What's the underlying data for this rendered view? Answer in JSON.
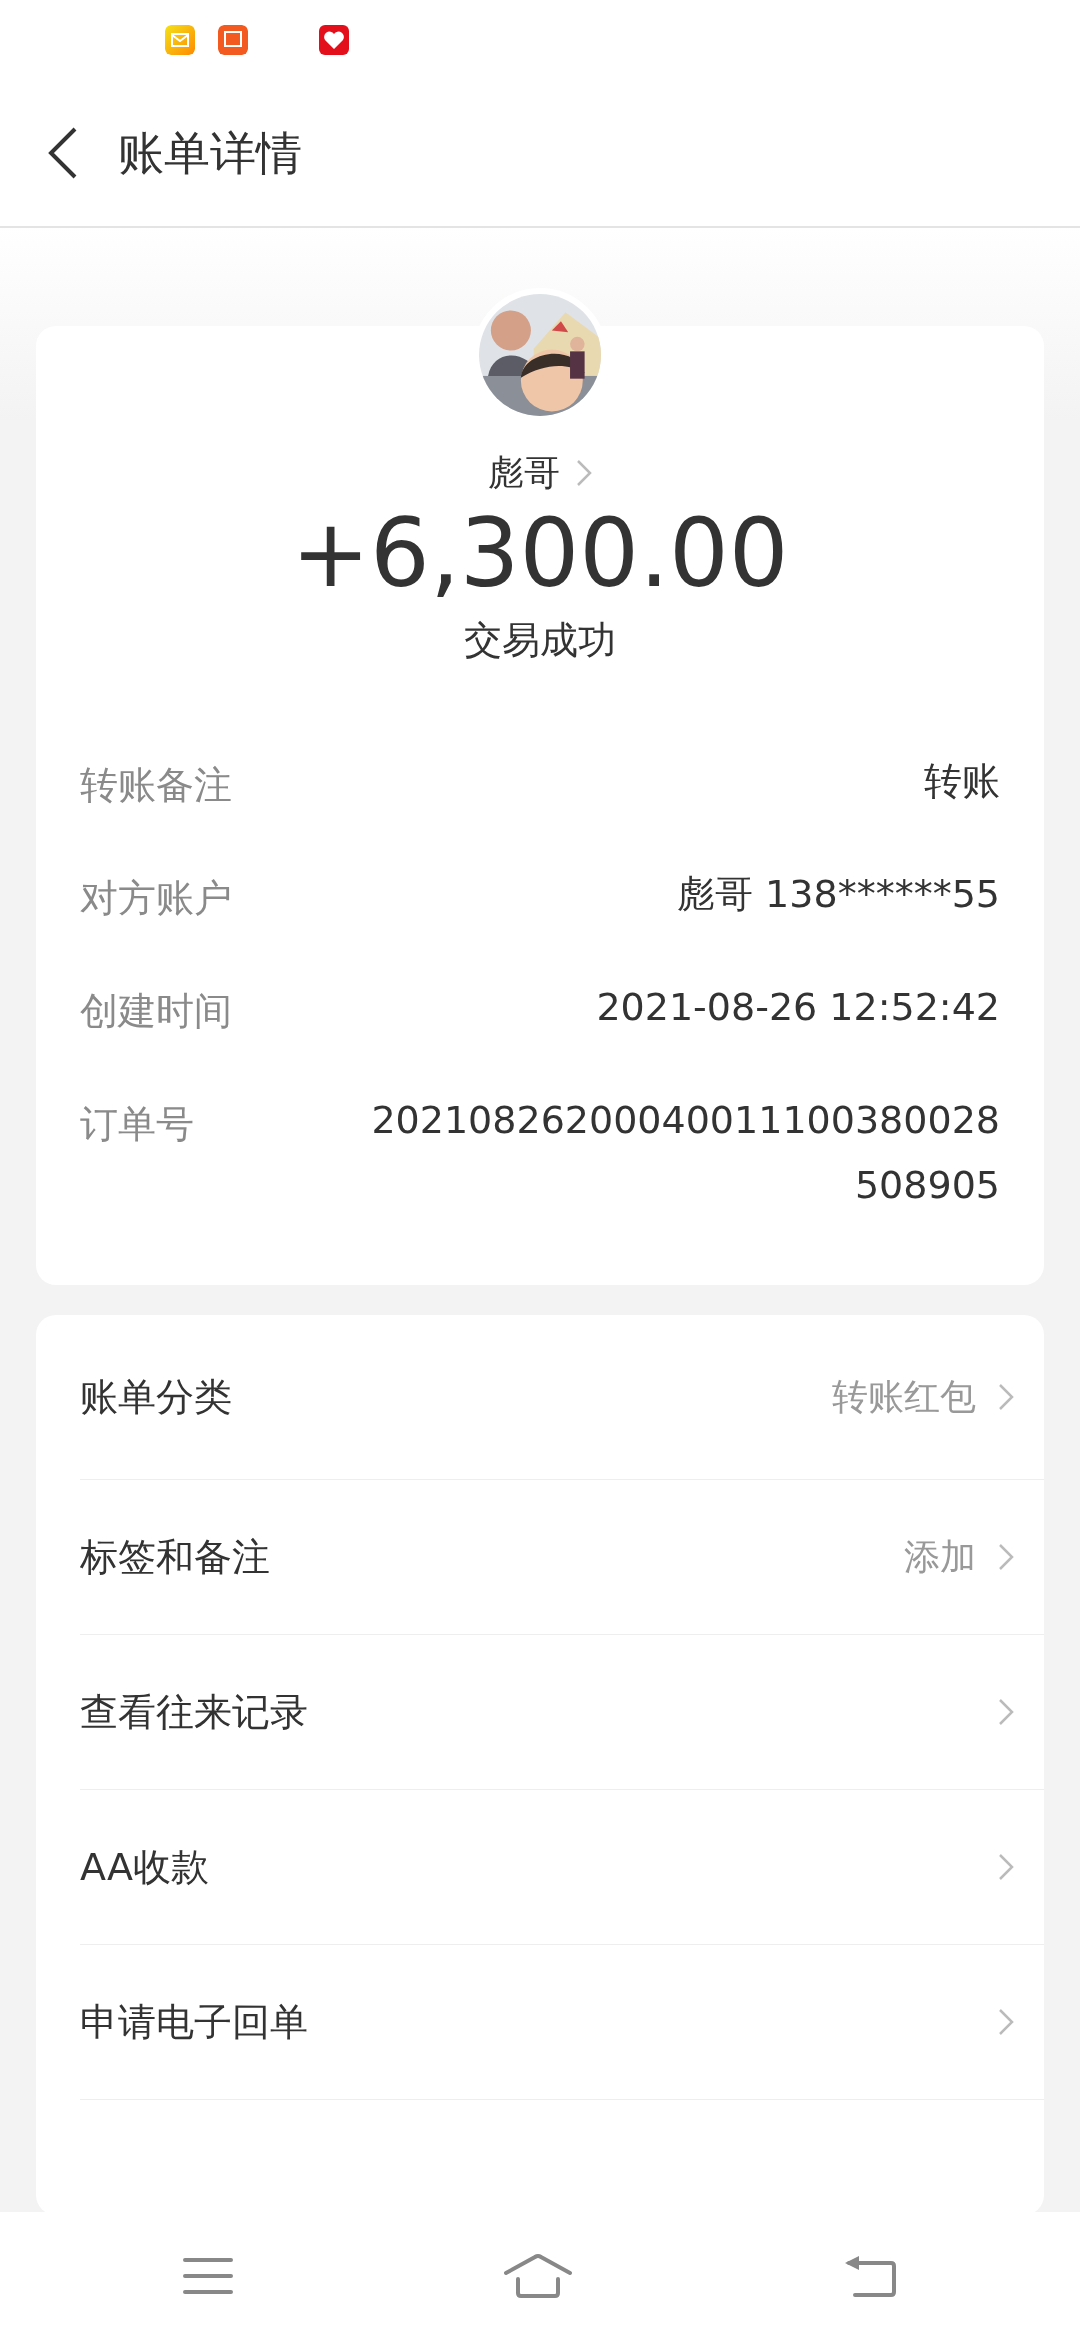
{
  "header": {
    "title": "账单详情"
  },
  "payer": {
    "name": "彪哥",
    "amount": "+6,300.00",
    "status": "交易成功"
  },
  "details": [
    {
      "label": "转账备注",
      "value": "转账"
    },
    {
      "label": "对方账户",
      "value": "彪哥 138******55"
    },
    {
      "label": "创建时间",
      "value": "2021-08-26 12:52:42"
    },
    {
      "label": "订单号",
      "value": "20210826200040011100380028508905"
    }
  ],
  "actions": [
    {
      "label": "账单分类",
      "value": "转账红包"
    },
    {
      "label": "标签和备注",
      "value": "添加"
    },
    {
      "label": "查看往来记录"
    },
    {
      "label": "AA收款"
    },
    {
      "label": "申请电子回单"
    }
  ]
}
